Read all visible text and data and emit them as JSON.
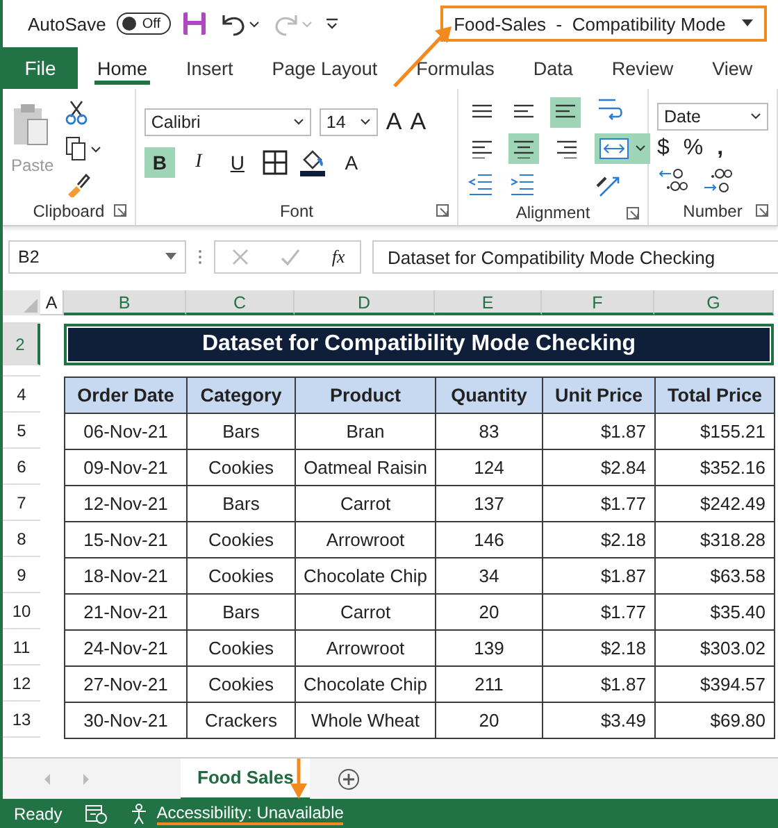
{
  "title_bar": {
    "autosave_label": "AutoSave",
    "autosave": {
      "on": false,
      "label": "Off"
    },
    "title": "Food-Sales  -  Compatibility Mode"
  },
  "tabs": [
    {
      "label": "File",
      "kind": "file",
      "selected": false
    },
    {
      "label": "Home",
      "kind": "tab",
      "selected": true
    },
    {
      "label": "Insert",
      "kind": "tab",
      "selected": false
    },
    {
      "label": "Page Layout",
      "kind": "tab",
      "selected": false
    },
    {
      "label": "Formulas",
      "kind": "tab",
      "selected": false
    },
    {
      "label": "Data",
      "kind": "tab",
      "selected": false
    },
    {
      "label": "Review",
      "kind": "tab",
      "selected": false
    },
    {
      "label": "View",
      "kind": "tab",
      "selected": false
    }
  ],
  "ribbon": {
    "clipboard": {
      "paste": "Paste",
      "label": "Clipboard"
    },
    "font": {
      "name": "Calibri",
      "size": "14",
      "grow": "A",
      "shrink": "A",
      "bold": {
        "label": "B",
        "on": true
      },
      "italic": "I",
      "underline": "U",
      "font_color": "A",
      "label": "Font"
    },
    "alignment": {
      "label": "Alignment",
      "buttons": [
        {
          "kind": "top",
          "selected": false
        },
        {
          "kind": "middle",
          "selected": false
        },
        {
          "kind": "bottom",
          "selected": true
        },
        {
          "kind": "left",
          "selected": false
        },
        {
          "kind": "center",
          "selected": true
        },
        {
          "kind": "right",
          "selected": false
        }
      ],
      "merge_on": true
    },
    "number": {
      "format": "Date",
      "currency": "$",
      "percent": "%",
      "comma": ",",
      "label": "Number"
    }
  },
  "formula_bar": {
    "name_box": "B2",
    "fx": "fx",
    "formula": "Dataset for Compatibility Mode Checking"
  },
  "columns": [
    {
      "label": "A",
      "selected": false
    },
    {
      "label": "B",
      "selected": true
    },
    {
      "label": "C",
      "selected": true
    },
    {
      "label": "D",
      "selected": true
    },
    {
      "label": "E",
      "selected": true
    },
    {
      "label": "F",
      "selected": true
    },
    {
      "label": "G",
      "selected": true
    }
  ],
  "sheet": {
    "title": "Dataset for Compatibility Mode Checking",
    "headers": [
      "Order Date",
      "Category",
      "Product",
      "Quantity",
      "Unit Price",
      "Total Price"
    ],
    "rows": [
      [
        "06-Nov-21",
        "Bars",
        "Bran",
        "83",
        "$1.87",
        "$155.21"
      ],
      [
        "09-Nov-21",
        "Cookies",
        "Oatmeal Raisin",
        "124",
        "$2.84",
        "$352.16"
      ],
      [
        "12-Nov-21",
        "Bars",
        "Carrot",
        "137",
        "$1.77",
        "$242.49"
      ],
      [
        "15-Nov-21",
        "Cookies",
        "Arrowroot",
        "146",
        "$2.18",
        "$318.28"
      ],
      [
        "18-Nov-21",
        "Cookies",
        "Chocolate Chip",
        "34",
        "$1.87",
        "$63.58"
      ],
      [
        "21-Nov-21",
        "Bars",
        "Carrot",
        "20",
        "$1.77",
        "$35.40"
      ],
      [
        "24-Nov-21",
        "Cookies",
        "Arrowroot",
        "139",
        "$2.18",
        "$303.02"
      ],
      [
        "27-Nov-21",
        "Cookies",
        "Chocolate Chip",
        "211",
        "$1.87",
        "$394.57"
      ],
      [
        "30-Nov-21",
        "Crackers",
        "Whole Wheat",
        "20",
        "$3.49",
        "$69.80"
      ]
    ]
  },
  "row_numbers": [
    {
      "label": "2",
      "selected": true
    },
    {
      "label": "4",
      "selected": false
    },
    {
      "label": "5",
      "selected": false
    },
    {
      "label": "6",
      "selected": false
    },
    {
      "label": "7",
      "selected": false
    },
    {
      "label": "8",
      "selected": false
    },
    {
      "label": "9",
      "selected": false
    },
    {
      "label": "10",
      "selected": false
    },
    {
      "label": "11",
      "selected": false
    },
    {
      "label": "12",
      "selected": false
    },
    {
      "label": "13",
      "selected": false
    }
  ],
  "sheet_tabs": [
    {
      "label": "Food Sales",
      "selected": true
    }
  ],
  "status_bar": {
    "ready": "Ready",
    "accessibility": "Accessibility: Unavailable"
  }
}
